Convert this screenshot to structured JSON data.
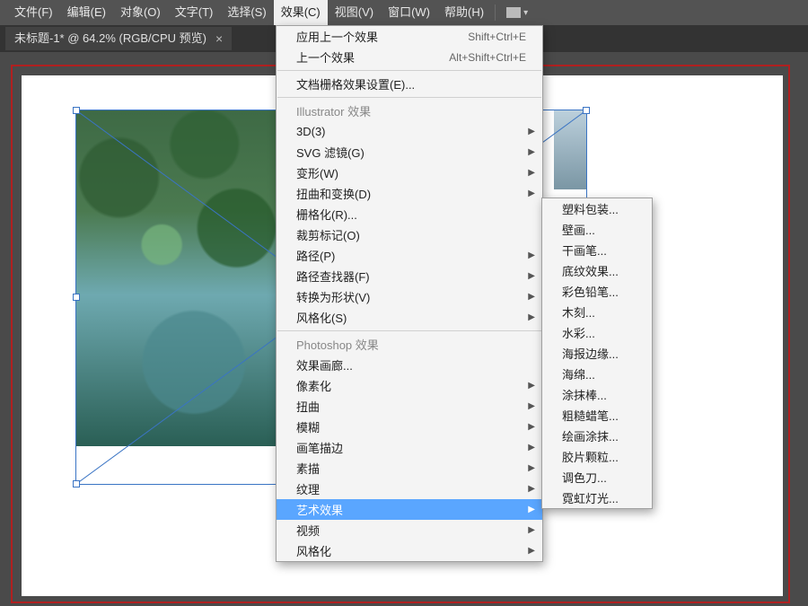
{
  "menubar": {
    "items": [
      {
        "label": "文件(F)"
      },
      {
        "label": "编辑(E)"
      },
      {
        "label": "对象(O)"
      },
      {
        "label": "文字(T)"
      },
      {
        "label": "选择(S)"
      },
      {
        "label": "效果(C)",
        "active": true
      },
      {
        "label": "视图(V)"
      },
      {
        "label": "窗口(W)"
      },
      {
        "label": "帮助(H)"
      }
    ]
  },
  "tab": {
    "title": "未标题-1* @ 64.2% (RGB/CPU 预览)"
  },
  "effects_menu": {
    "section_top": [
      {
        "label": "应用上一个效果",
        "shortcut": "Shift+Ctrl+E"
      },
      {
        "label": "上一个效果",
        "shortcut": "Alt+Shift+Ctrl+E"
      }
    ],
    "doc_raster": {
      "label": "文档栅格效果设置(E)..."
    },
    "header_illustrator": "Illustrator 效果",
    "illustrator": [
      {
        "label": "3D(3)",
        "sub": true
      },
      {
        "label": "SVG 滤镜(G)",
        "sub": true
      },
      {
        "label": "变形(W)",
        "sub": true
      },
      {
        "label": "扭曲和变换(D)",
        "sub": true
      },
      {
        "label": "栅格化(R)..."
      },
      {
        "label": "裁剪标记(O)"
      },
      {
        "label": "路径(P)",
        "sub": true
      },
      {
        "label": "路径查找器(F)",
        "sub": true
      },
      {
        "label": "转换为形状(V)",
        "sub": true
      },
      {
        "label": "风格化(S)",
        "sub": true
      }
    ],
    "header_photoshop": "Photoshop 效果",
    "photoshop": [
      {
        "label": "效果画廊..."
      },
      {
        "label": "像素化",
        "sub": true
      },
      {
        "label": "扭曲",
        "sub": true
      },
      {
        "label": "模糊",
        "sub": true
      },
      {
        "label": "画笔描边",
        "sub": true
      },
      {
        "label": "素描",
        "sub": true
      },
      {
        "label": "纹理",
        "sub": true
      },
      {
        "label": "艺术效果",
        "sub": true,
        "selected": true
      },
      {
        "label": "视频",
        "sub": true
      },
      {
        "label": "风格化",
        "sub": true
      }
    ]
  },
  "artistic_submenu": [
    {
      "label": "塑料包装..."
    },
    {
      "label": "壁画..."
    },
    {
      "label": "干画笔..."
    },
    {
      "label": "底纹效果..."
    },
    {
      "label": "彩色铅笔..."
    },
    {
      "label": "木刻..."
    },
    {
      "label": "水彩..."
    },
    {
      "label": "海报边缘..."
    },
    {
      "label": "海绵..."
    },
    {
      "label": "涂抹棒..."
    },
    {
      "label": "粗糙蜡笔..."
    },
    {
      "label": "绘画涂抹..."
    },
    {
      "label": "胶片颗粒..."
    },
    {
      "label": "调色刀..."
    },
    {
      "label": "霓虹灯光..."
    }
  ]
}
